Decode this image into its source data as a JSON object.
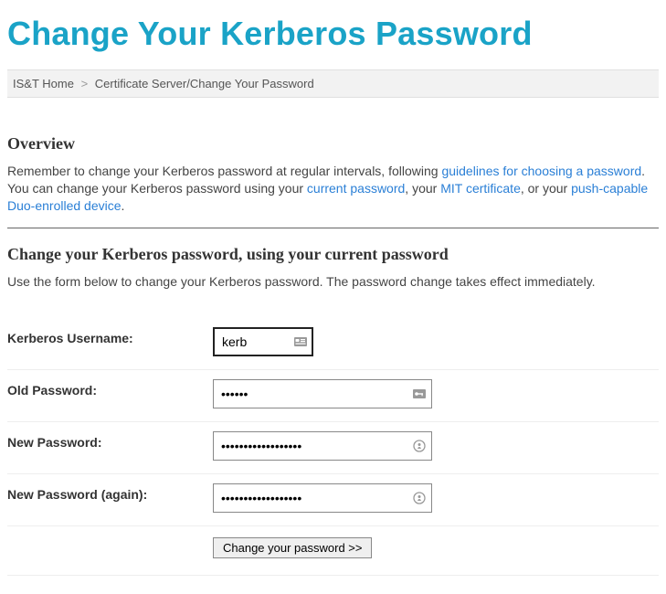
{
  "title": "Change Your Kerberos Password",
  "breadcrumb": {
    "home": "IS&T Home",
    "sep": ">",
    "path": "Certificate Server/Change Your Password"
  },
  "overview": {
    "heading": "Overview",
    "text_a": "Remember to change your Kerberos password at regular intervals, following ",
    "link_guidelines": "guidelines for choosing a password",
    "text_b": ". You can change your Kerberos password using your ",
    "link_current": "current password",
    "text_c": ", your ",
    "link_cert": "MIT certificate",
    "text_d": ", or your ",
    "link_duo": "push-capable Duo-enrolled device",
    "text_e": "."
  },
  "form_section": {
    "heading": "Change your Kerberos password, using your current password",
    "desc": "Use the form below to change your Kerberos password. The password change takes effect immediately."
  },
  "form": {
    "username_label": "Kerberos Username:",
    "username_value": "kerb",
    "oldpw_label": "Old Password:",
    "oldpw_value": "••••••",
    "newpw_label": "New Password:",
    "newpw_value": "••••••••••••••••••",
    "newpw2_label": "New Password (again):",
    "newpw2_value": "••••••••••••••••••",
    "submit_label": "Change your password >>"
  }
}
